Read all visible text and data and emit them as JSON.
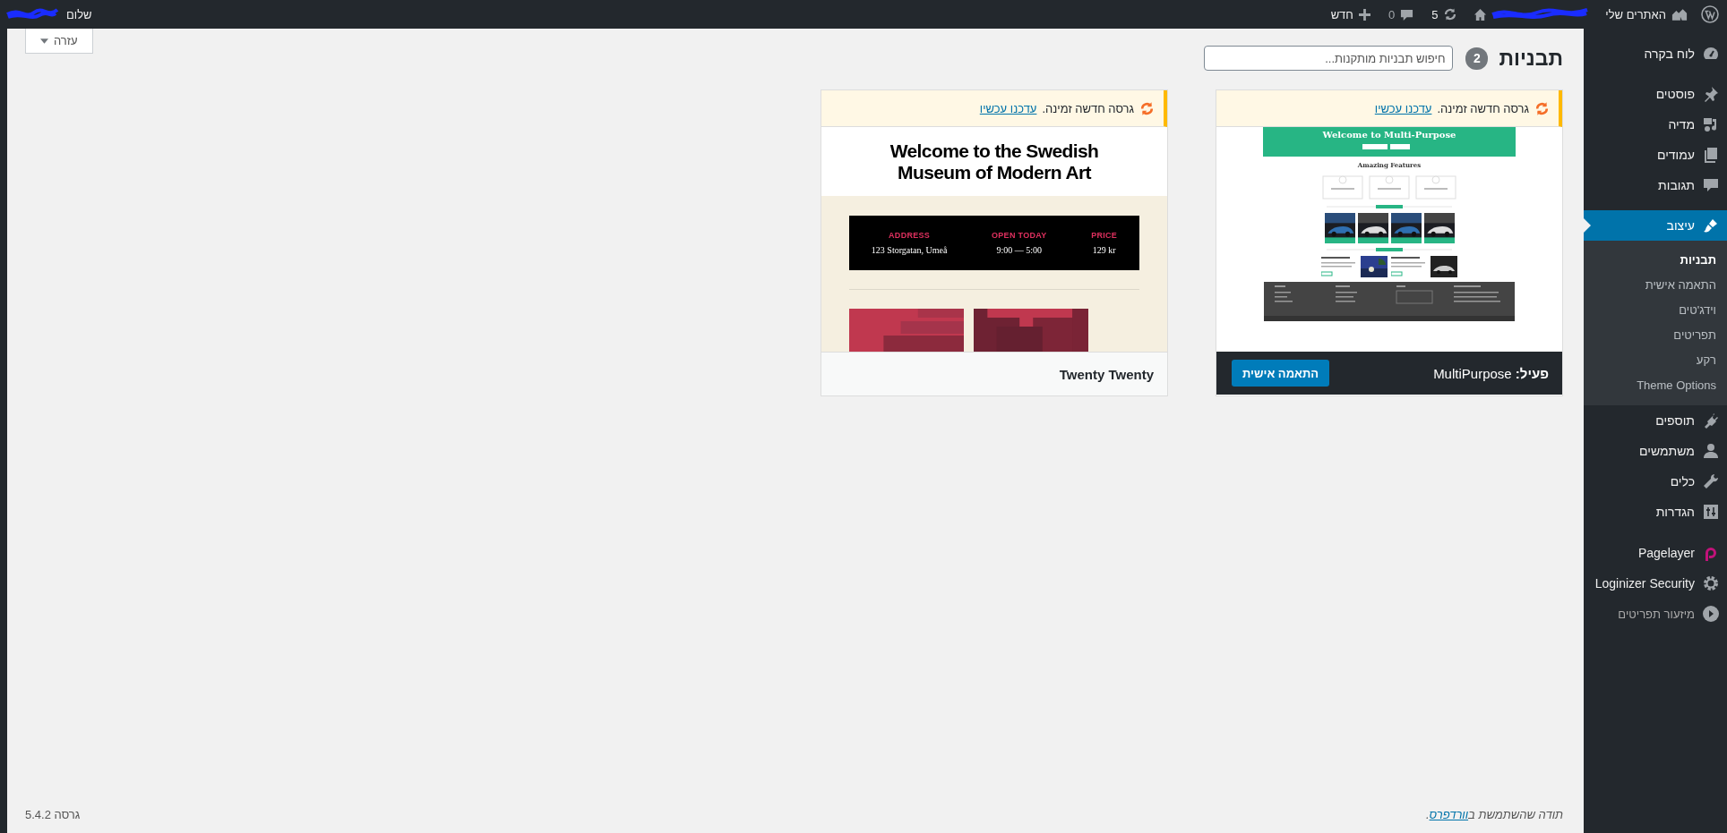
{
  "admin_bar": {
    "my_sites": "האתרים שלי",
    "updates": "5",
    "comments": "0",
    "new": "חדש",
    "greeting": "שלום"
  },
  "sidebar": {
    "groups": [
      {
        "items": [
          {
            "label": "לוח בקרה",
            "kind": "link",
            "selected": false
          }
        ]
      },
      {
        "items": [
          {
            "label": "פוסטים",
            "kind": "link",
            "selected": false
          },
          {
            "label": "מדיה",
            "kind": "link",
            "selected": false
          },
          {
            "label": "עמודים",
            "kind": "link",
            "selected": false
          },
          {
            "label": "תגובות",
            "kind": "link",
            "selected": false
          }
        ]
      },
      {
        "items": [
          {
            "label": "עיצוב",
            "kind": "link",
            "selected": true,
            "children": [
              {
                "label": "תבניות",
                "selected": true
              },
              {
                "label": "התאמה אישית",
                "selected": false
              },
              {
                "label": "וידג'טים",
                "selected": false
              },
              {
                "label": "תפריטים",
                "selected": false
              },
              {
                "label": "רקע",
                "selected": false
              },
              {
                "label": "Theme Options",
                "selected": false
              }
            ]
          },
          {
            "label": "תוספים",
            "kind": "link",
            "selected": false
          },
          {
            "label": "משתמשים",
            "kind": "link",
            "selected": false
          },
          {
            "label": "כלים",
            "kind": "link",
            "selected": false
          },
          {
            "label": "הגדרות",
            "kind": "link",
            "selected": false
          }
        ]
      },
      {
        "items": [
          {
            "label": "Pagelayer",
            "kind": "link",
            "selected": false
          },
          {
            "label": "Loginizer Security",
            "kind": "link",
            "selected": false
          },
          {
            "label": "מיזעור תפריטים",
            "kind": "collapse",
            "selected": false
          }
        ]
      }
    ]
  },
  "page": {
    "title": "תבניות",
    "count": "2",
    "search": {
      "placeholder": "חיפוש תבניות מותקנות..."
    },
    "help": "עזרה"
  },
  "themes": [
    {
      "name": "MultiPurpose",
      "active": true,
      "active_label": "פעיל:",
      "button": "התאמה אישית",
      "notice": {
        "text": "גרסה חדשה זמינה.",
        "link": "עדכנו עכשיו"
      },
      "preview": {
        "kind": "multipurpose",
        "heading": "Welcome to Multi-Purpose",
        "section": "Amazing Features"
      }
    },
    {
      "name": "Twenty Twenty",
      "active": false,
      "notice": {
        "text": "גרסה חדשה זמינה.",
        "link": "עדכנו עכשיו"
      },
      "preview": {
        "kind": "twentytwenty",
        "heading": "Welcome to the Swedish Museum of Modern Art",
        "info": [
          {
            "label": "PRICE",
            "value": "129 kr"
          },
          {
            "label": "OPEN TODAY",
            "value": "9:00 — 5:00"
          },
          {
            "label": "ADDRESS",
            "value": "123 Storgatan, Umeå"
          }
        ]
      }
    }
  ],
  "footer": {
    "thanks": "תודה שהשתמשת ב",
    "link": "וורדפרס",
    "end": ".",
    "version": "גרסה 5.4.2"
  }
}
